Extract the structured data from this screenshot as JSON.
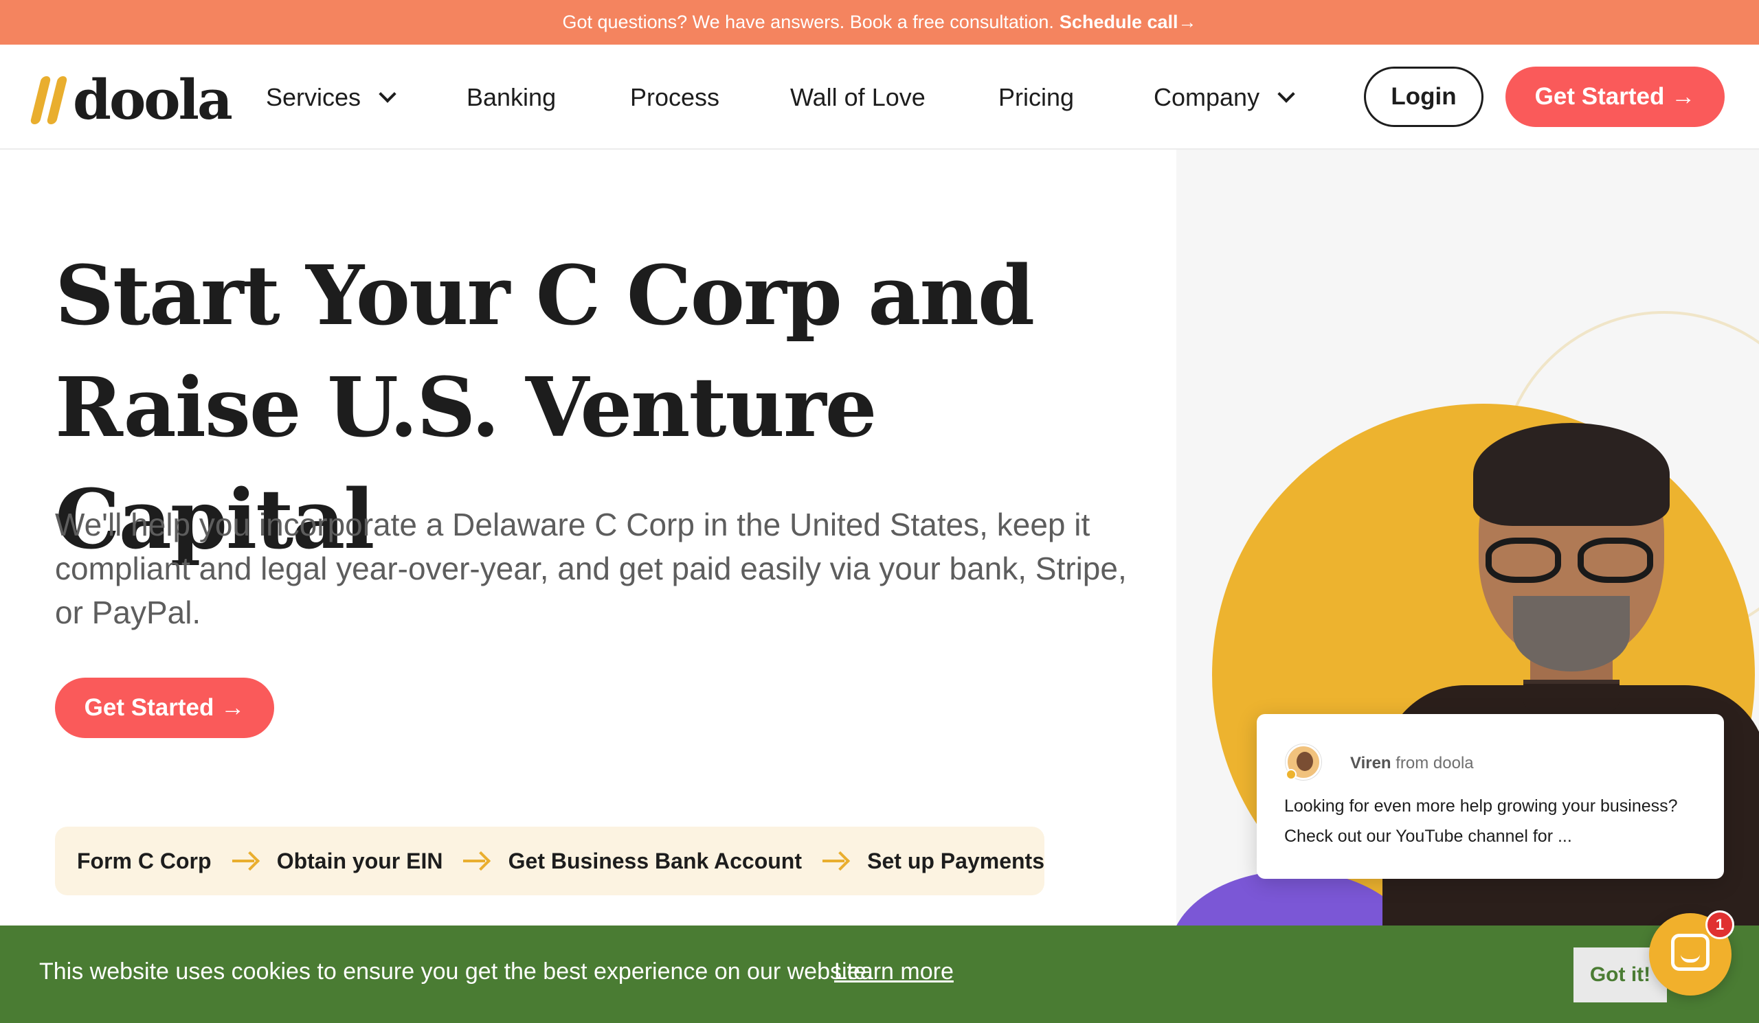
{
  "announcement": {
    "message": "Got questions? We have answers. Book a free consultation.",
    "cta": "Schedule call→"
  },
  "header": {
    "logo_text": "doola",
    "nav": [
      {
        "label": "Services",
        "has_dropdown": true
      },
      {
        "label": "Banking",
        "has_dropdown": false
      },
      {
        "label": "Process",
        "has_dropdown": false
      },
      {
        "label": "Wall of Love",
        "has_dropdown": false
      },
      {
        "label": "Pricing",
        "has_dropdown": false
      },
      {
        "label": "Company",
        "has_dropdown": true
      }
    ],
    "login_label": "Login",
    "get_started_label": "Get Started",
    "arrow": "→"
  },
  "hero": {
    "title_line1": "Start Your C Corp and",
    "title_line2": "Raise U.S. Venture Capital",
    "subtitle": "We'll help you incorporate a Delaware C Corp in the United States, keep it compliant and legal year-over-year, and get paid easily via your bank, Stripe, or PayPal.",
    "cta_label": "Get Started",
    "steps": [
      "Form C Corp",
      "Obtain your EIN",
      "Get Business Bank Account",
      "Set up Payments"
    ]
  },
  "chat_popup": {
    "sender_name": "Viren",
    "sender_suffix": "from doola",
    "message": "Looking for even more help growing your business? Check out our YouTube channel for ..."
  },
  "cookie": {
    "text": "This website uses cookies to ensure you get the best experience on our website.",
    "learn_more": "Learn more",
    "accept": "Got it!"
  },
  "chat_launcher": {
    "badge_count": "1"
  },
  "colors": {
    "announcement_bg": "#f4845f",
    "brand_red": "#fa5a5a",
    "brand_yellow": "#edb32f",
    "cookie_green": "#4a7c33",
    "steps_bg": "#fcf3e1"
  },
  "icons": {
    "logo_mark": "double-slash-logo-icon",
    "dropdown": "chevron-down-icon",
    "step_separator": "arrow-right-icon",
    "chat": "chat-bubble-icon"
  }
}
